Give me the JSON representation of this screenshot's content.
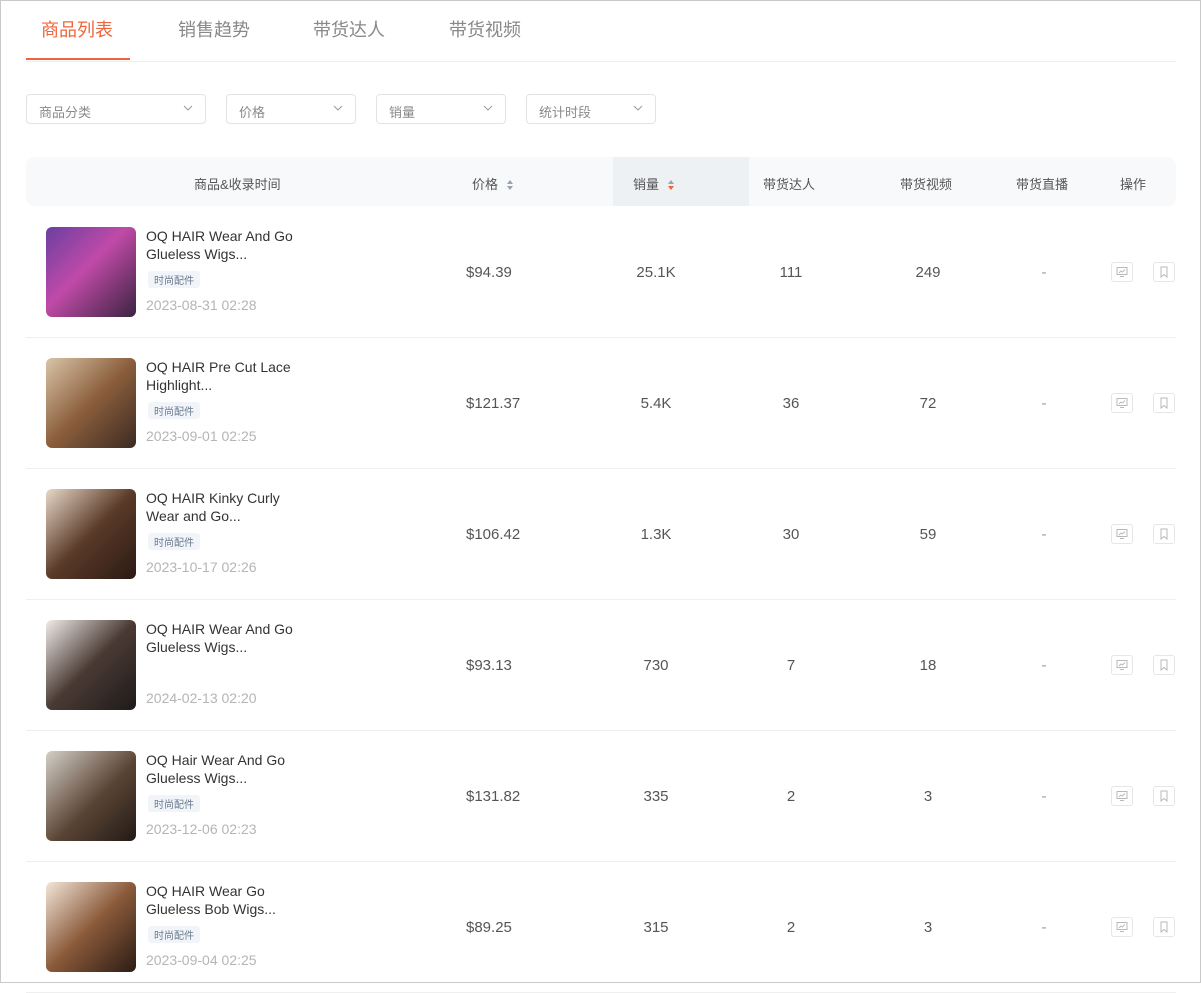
{
  "tabs": [
    {
      "label": "商品列表",
      "active": true
    },
    {
      "label": "销售趋势",
      "active": false
    },
    {
      "label": "带货达人",
      "active": false
    },
    {
      "label": "带货视频",
      "active": false
    }
  ],
  "filters": [
    {
      "placeholder": "商品分类"
    },
    {
      "placeholder": "价格"
    },
    {
      "placeholder": "销量"
    },
    {
      "placeholder": "统计时段"
    }
  ],
  "columns": {
    "product": "商品&收录时间",
    "price": "价格",
    "sales": "销量",
    "influencers": "带货达人",
    "videos": "带货视频",
    "live": "带货直播",
    "actions": "操作"
  },
  "products": [
    {
      "title": "OQ HAIR Wear And Go Glueless Wigs...",
      "tag": "时尚配件",
      "time": "2023-08-31 02:28",
      "price": "$94.39",
      "sales": "25.1K",
      "influencers": "111",
      "videos": "249",
      "live": "-"
    },
    {
      "title": "OQ HAIR Pre Cut Lace Highlight...",
      "tag": "时尚配件",
      "time": "2023-09-01 02:25",
      "price": "$121.37",
      "sales": "5.4K",
      "influencers": "36",
      "videos": "72",
      "live": "-"
    },
    {
      "title": "OQ HAIR Kinky Curly Wear and Go...",
      "tag": "时尚配件",
      "time": "2023-10-17 02:26",
      "price": "$106.42",
      "sales": "1.3K",
      "influencers": "30",
      "videos": "59",
      "live": "-"
    },
    {
      "title": "OQ HAIR Wear And Go Glueless Wigs...",
      "tag": "",
      "time": "2024-02-13 02:20",
      "price": "$93.13",
      "sales": "730",
      "influencers": "7",
      "videos": "18",
      "live": "-"
    },
    {
      "title": "OQ Hair Wear And Go Glueless Wigs...",
      "tag": "时尚配件",
      "time": "2023-12-06 02:23",
      "price": "$131.82",
      "sales": "335",
      "influencers": "2",
      "videos": "3",
      "live": "-"
    },
    {
      "title": "OQ HAIR Wear Go Glueless Bob Wigs...",
      "tag": "时尚配件",
      "time": "2023-09-04 02:25",
      "price": "$89.25",
      "sales": "315",
      "influencers": "2",
      "videos": "3",
      "live": "-"
    }
  ],
  "colors": {
    "accent": "#f0643a",
    "sort_active": "#f0643a"
  }
}
